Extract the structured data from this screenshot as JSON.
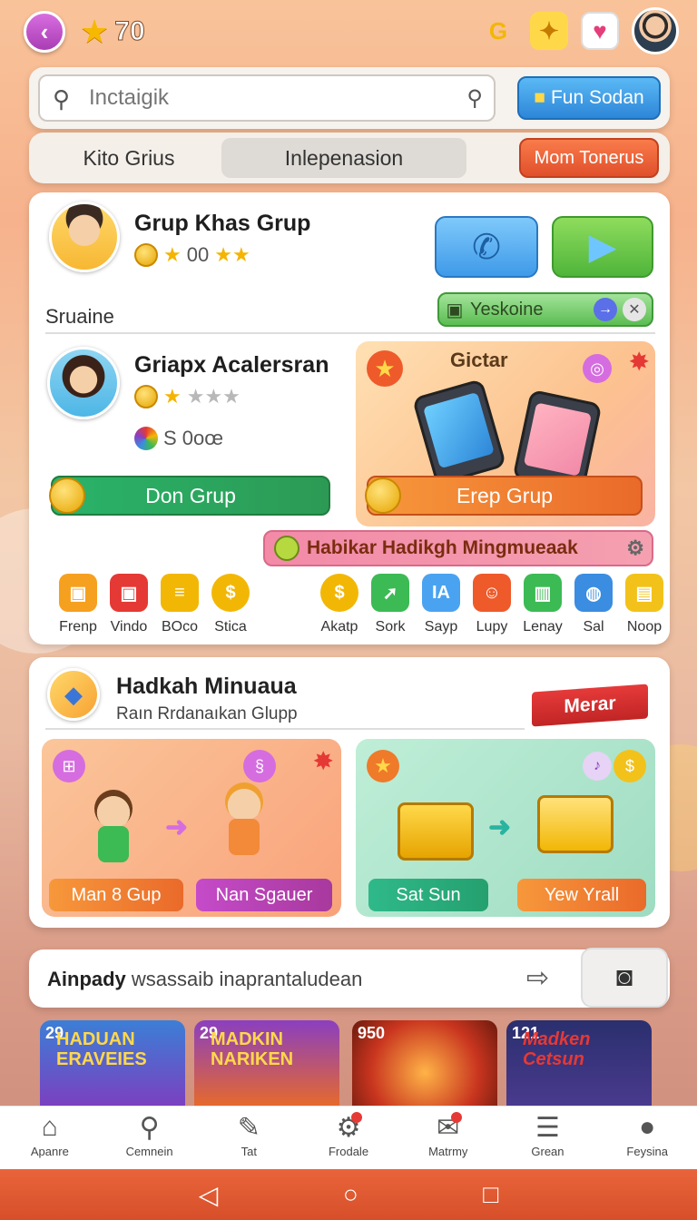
{
  "topbar": {
    "star_count": "70",
    "icons": [
      "back-icon",
      "star-icon",
      "gold-g-icon",
      "puzzle-icon",
      "card-icon"
    ]
  },
  "search": {
    "placeholder": "Inctaigik",
    "action_label": "Fun Sodan"
  },
  "tabs": [
    {
      "label": "Kito Grius"
    },
    {
      "label": "Inlepenasion"
    },
    {
      "label": "Mom Tonerus"
    }
  ],
  "profile1": {
    "name": "Grup Khas Grup",
    "stat": "00",
    "tag_label": "Yeskoine"
  },
  "section_label": "Sruaine",
  "profile2": {
    "name": "Griapx Acalersran",
    "stat": "S 0oœ"
  },
  "promo": {
    "title": "Gictar"
  },
  "buttons": {
    "green": "Don Grup",
    "orange": "Erep Grup"
  },
  "banner": "Habikar Hadikgh Mingmueaak",
  "icon_row_left": [
    {
      "label": "Frenp",
      "icon": "gift-icon",
      "color": "#f6a020"
    },
    {
      "label": "Vindo",
      "icon": "red-gift-icon",
      "color": "#e53935"
    },
    {
      "label": "BOco",
      "icon": "gold-stack-icon",
      "color": "#f2b705"
    },
    {
      "label": "Stica",
      "icon": "coin-icon",
      "color": "#f2b705"
    }
  ],
  "icon_row_right": [
    {
      "label": "Akatp",
      "icon": "coin-icon",
      "color": "#f2b705"
    },
    {
      "label": "Sork",
      "icon": "rocket-icon",
      "color": "#3cba54"
    },
    {
      "label": "Sayp",
      "icon": "ia-icon",
      "color": "#4aa3f0"
    },
    {
      "label": "Lupy",
      "icon": "face-icon",
      "color": "#ef5a2a"
    },
    {
      "label": "Lenay",
      "icon": "chart-icon",
      "color": "#3cba54"
    },
    {
      "label": "Sal",
      "icon": "ball-icon",
      "color": "#3a8de0"
    },
    {
      "label": "Noop",
      "icon": "box-icon",
      "color": "#f2c21a"
    }
  ],
  "card2": {
    "title": "Hadkah Minuaua",
    "subtitle": "Raın Rrdanaıkan Glupp",
    "ribbon": "Merar",
    "tile1": {
      "left_pill": "Man 8 Gup",
      "right_pill": "Nan Sgauer"
    },
    "tile2": {
      "left_pill": "Sat Sun",
      "right_pill": "Yew Yrall"
    }
  },
  "feed": {
    "header": "Ainpady",
    "header_rest": "wsassaib inaprantaludean",
    "thumbs": [
      {
        "badge": "29",
        "title": "HADUAN ERAVEIES",
        "bg": "#3b7fd6"
      },
      {
        "badge": "29",
        "title": "MADKIN NARIKEN",
        "bg": "#8a3fc0"
      },
      {
        "badge": "950",
        "title": "",
        "bg": "#c9351f"
      },
      {
        "badge": "121",
        "title": "Madken Cetsun",
        "bg": "#2a2f6e"
      }
    ]
  },
  "bottom_nav": [
    {
      "label": "Apanre",
      "icon": "home-icon"
    },
    {
      "label": "Cemnein",
      "icon": "search-icon"
    },
    {
      "label": "Tat",
      "icon": "pencil-icon"
    },
    {
      "label": "Frodale",
      "icon": "gear-icon"
    },
    {
      "label": "Matrmy",
      "icon": "mail-icon"
    },
    {
      "label": "Grean",
      "icon": "list-icon"
    },
    {
      "label": "Feysina",
      "icon": "person-icon"
    }
  ]
}
